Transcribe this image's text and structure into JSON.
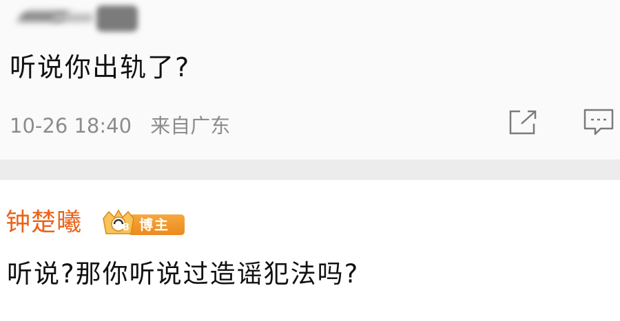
{
  "post": {
    "text": "听说你出轨了?",
    "timestamp": "10-26 18:40",
    "source": "来自广东",
    "share_icon": "share-icon",
    "comment_icon": "comment-icon"
  },
  "comment": {
    "author": "钟楚曦",
    "badge_label": "博主",
    "badge_level": "8",
    "text": "听说?那你听说过造谣犯法吗?"
  },
  "colors": {
    "author_name": "#e8641b",
    "badge": "#ec8a1f",
    "meta_text": "#8c8c8c",
    "divider": "#ececec"
  }
}
